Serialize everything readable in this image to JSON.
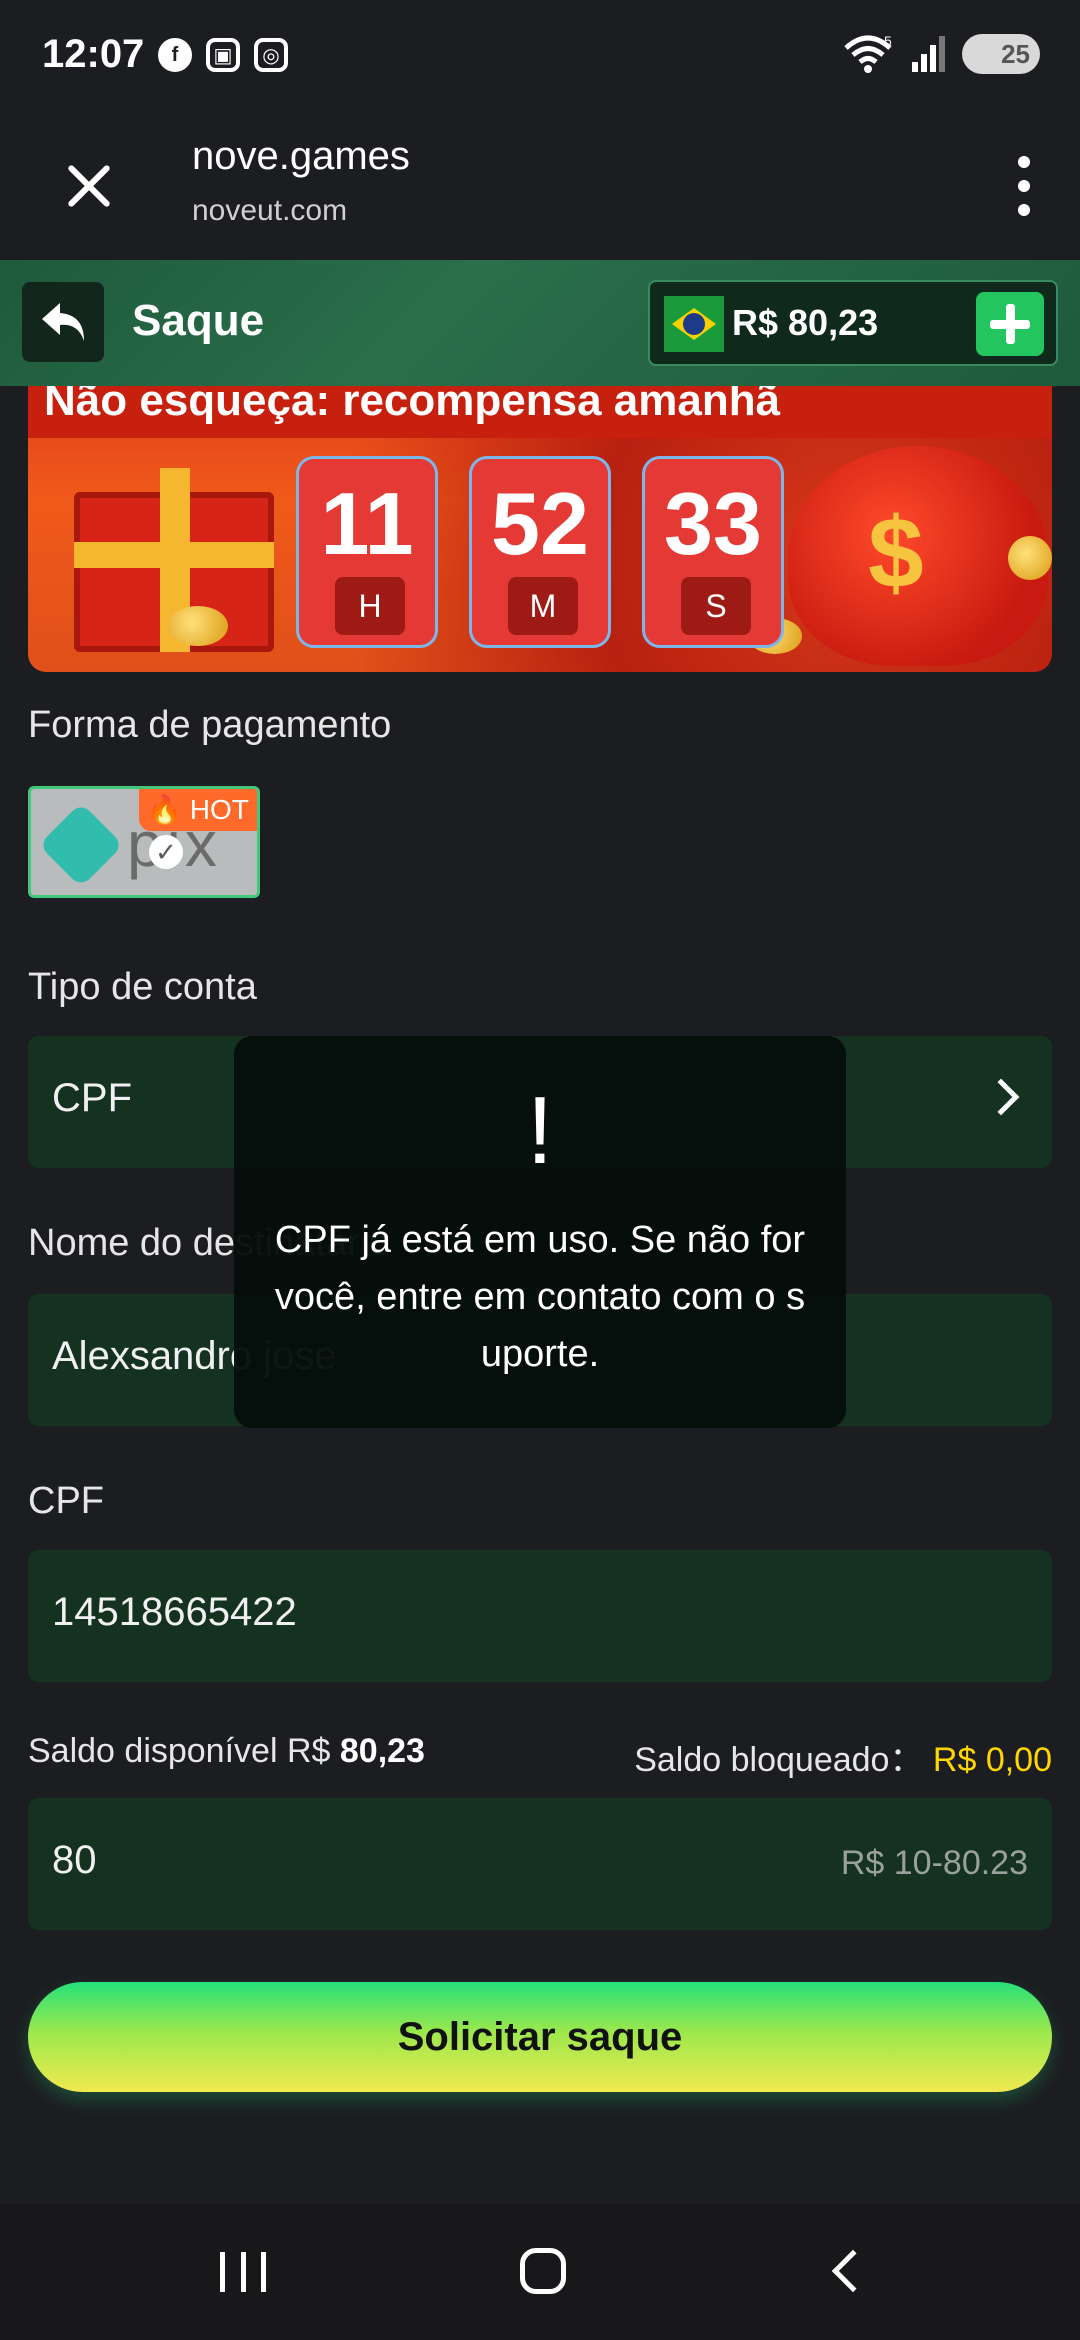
{
  "status_bar": {
    "time": "12:07",
    "battery": "25",
    "network_badge": "5",
    "icons": [
      "facebook-icon",
      "screenshot-icon",
      "instagram-icon",
      "wifi-icon",
      "signal-icon",
      "battery-icon"
    ]
  },
  "browser": {
    "title": "nove.games",
    "url": "noveut.com"
  },
  "header": {
    "title": "Saque",
    "balance": "R$ 80,23"
  },
  "banner": {
    "text": "Não esqueça: recompensa amanhã",
    "timer": [
      {
        "value": "11",
        "label": "H"
      },
      {
        "value": "52",
        "label": "M"
      },
      {
        "value": "33",
        "label": "S"
      }
    ]
  },
  "form": {
    "payment_label": "Forma de pagamento",
    "payment_method": {
      "name": "pix",
      "badge": "HOT"
    },
    "account_type_label": "Tipo de conta",
    "account_type_value": "CPF",
    "recipient_label": "Nome do destinatário",
    "recipient_value": "Alexsandro jose",
    "cpf_label": "CPF",
    "cpf_value": "14518665422",
    "available_label": "Saldo disponível R$",
    "available_value": "80,23",
    "blocked_label": "Saldo bloqueado：",
    "blocked_value": "R$ 0,00",
    "amount_value": "80",
    "amount_placeholder": "R$ 10-80.23",
    "submit_label": "Solicitar saque"
  },
  "toast": {
    "icon": "!",
    "message": "CPF já está em uso. Se não for você, entre em contato com o suporte."
  },
  "colors": {
    "background": "#1c1d21",
    "field": "#14321f",
    "accent_green": "#22c55e",
    "yellow": "#ffd600",
    "header": "#2a6e4a"
  }
}
